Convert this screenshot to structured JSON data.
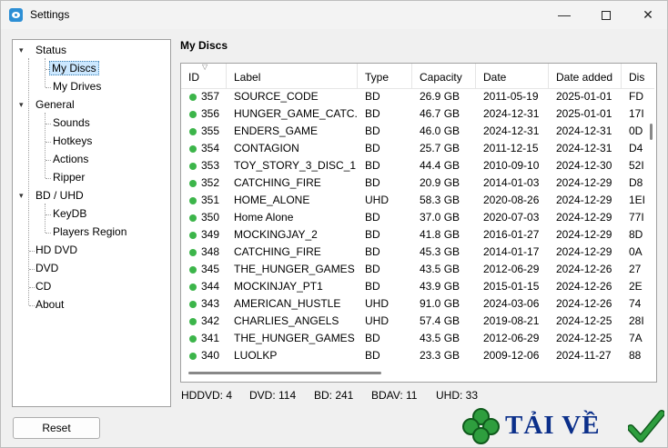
{
  "window": {
    "title": "Settings",
    "minimize": "—",
    "close": "✕"
  },
  "tree": {
    "status": "Status",
    "my_discs": "My Discs",
    "my_drives": "My Drives",
    "general": "General",
    "sounds": "Sounds",
    "hotkeys": "Hotkeys",
    "actions": "Actions",
    "ripper": "Ripper",
    "bd_uhd": "BD / UHD",
    "keydb": "KeyDB",
    "players_region": "Players Region",
    "hd_dvd": "HD DVD",
    "dvd": "DVD",
    "cd": "CD",
    "about": "About"
  },
  "section_title": "My Discs",
  "table": {
    "columns": [
      "ID",
      "Label",
      "Type",
      "Capacity",
      "Date",
      "Date added",
      "Dis"
    ],
    "rows": [
      [
        "357",
        "SOURCE_CODE",
        "BD",
        "26.9 GB",
        "2011-05-19",
        "2025-01-01",
        "FD"
      ],
      [
        "356",
        "HUNGER_GAME_CATC...",
        "BD",
        "46.7 GB",
        "2024-12-31",
        "2025-01-01",
        "17I"
      ],
      [
        "355",
        "ENDERS_GAME",
        "BD",
        "46.0 GB",
        "2024-12-31",
        "2024-12-31",
        "0D"
      ],
      [
        "354",
        "CONTAGION",
        "BD",
        "25.7 GB",
        "2011-12-15",
        "2024-12-31",
        "D4"
      ],
      [
        "353",
        "TOY_STORY_3_DISC_1",
        "BD",
        "44.4 GB",
        "2010-09-10",
        "2024-12-30",
        "52I"
      ],
      [
        "352",
        "CATCHING_FIRE",
        "BD",
        "20.9 GB",
        "2014-01-03",
        "2024-12-29",
        "D8"
      ],
      [
        "351",
        "HOME_ALONE",
        "UHD",
        "58.3 GB",
        "2020-08-26",
        "2024-12-29",
        "1EI"
      ],
      [
        "350",
        "Home Alone",
        "BD",
        "37.0 GB",
        "2020-07-03",
        "2024-12-29",
        "77I"
      ],
      [
        "349",
        "MOCKINGJAY_2",
        "BD",
        "41.8 GB",
        "2016-01-27",
        "2024-12-29",
        "8D"
      ],
      [
        "348",
        "CATCHING_FIRE",
        "BD",
        "45.3 GB",
        "2014-01-17",
        "2024-12-29",
        "0A"
      ],
      [
        "345",
        "THE_HUNGER_GAMES",
        "BD",
        "43.5 GB",
        "2012-06-29",
        "2024-12-26",
        "27"
      ],
      [
        "344",
        "MOCKINJAY_PT1",
        "BD",
        "43.9 GB",
        "2015-01-15",
        "2024-12-26",
        "2E"
      ],
      [
        "343",
        "AMERICAN_HUSTLE",
        "UHD",
        "91.0 GB",
        "2024-03-06",
        "2024-12-26",
        "74"
      ],
      [
        "342",
        "CHARLIES_ANGELS",
        "UHD",
        "57.4 GB",
        "2019-08-21",
        "2024-12-25",
        "28I"
      ],
      [
        "341",
        "THE_HUNGER_GAMES",
        "BD",
        "43.5 GB",
        "2012-06-29",
        "2024-12-25",
        "7A"
      ],
      [
        "340",
        "LUOLKP",
        "BD",
        "23.3 GB",
        "2009-12-06",
        "2024-11-27",
        "88"
      ]
    ]
  },
  "stats": {
    "hddvd": "HDDVD: 4",
    "dvd": "DVD: 114",
    "bd": "BD: 241",
    "bdav": "BDAV: 11",
    "uhd": "UHD: 33"
  },
  "reset_label": "Reset",
  "logo_text": "TẢI VỀ",
  "colors": {
    "status_ok": "#3cb54a",
    "selection": "#cce8ff",
    "logo_blue": "#0b2f8a",
    "logo_green": "#2e9e3e"
  }
}
